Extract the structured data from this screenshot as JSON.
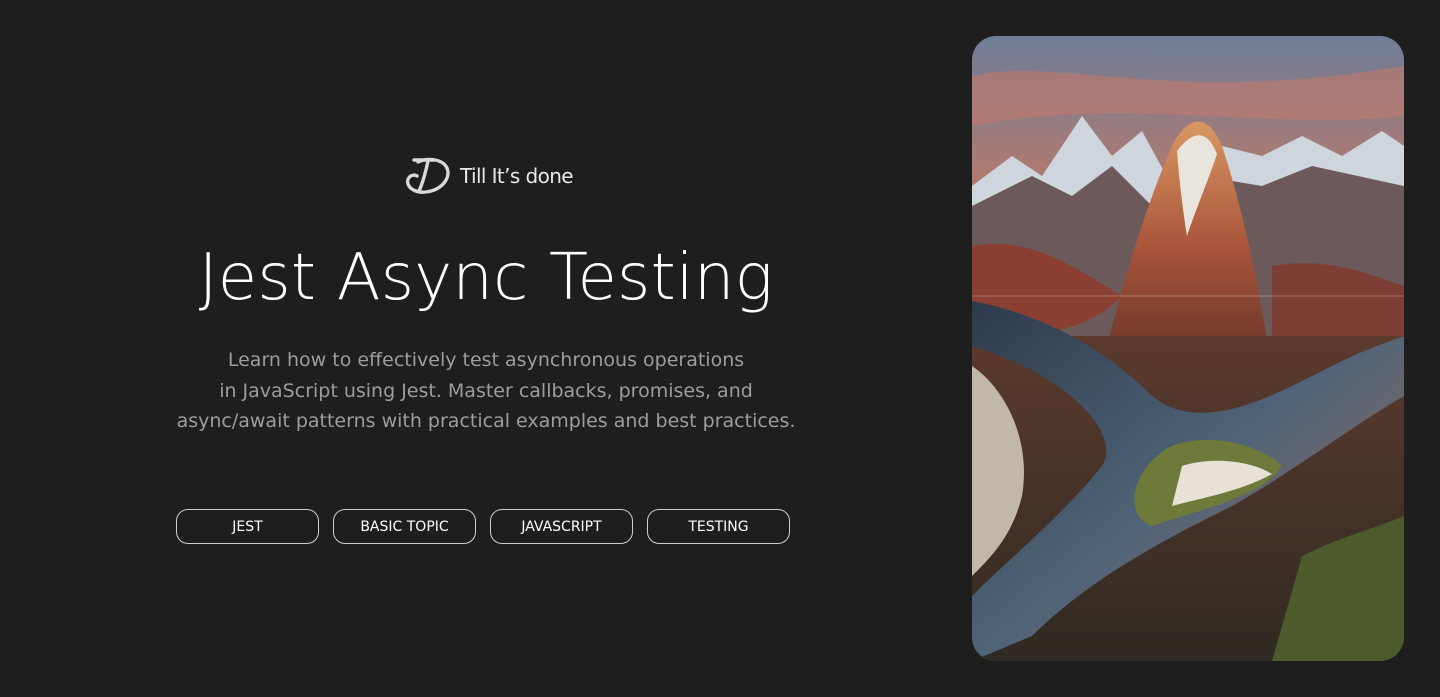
{
  "brand": {
    "name": "Till It’s done",
    "logo_icon": "d-monogram-icon"
  },
  "hero": {
    "title": "Jest Async Testing",
    "description_lines": [
      "Learn how to effectively test asynchronous operations",
      "in JavaScript using Jest. Master callbacks, promises, and",
      "async/await patterns with practical examples and best practices."
    ]
  },
  "tags": [
    {
      "label": "JEST"
    },
    {
      "label": "BASIC TOPIC"
    },
    {
      "label": "JAVASCRIPT"
    },
    {
      "label": "TESTING"
    }
  ],
  "colors": {
    "background": "#1e1e1e",
    "title": "#ffffff",
    "description": "#9d9d9d",
    "tag_border": "#cfcfcf"
  }
}
